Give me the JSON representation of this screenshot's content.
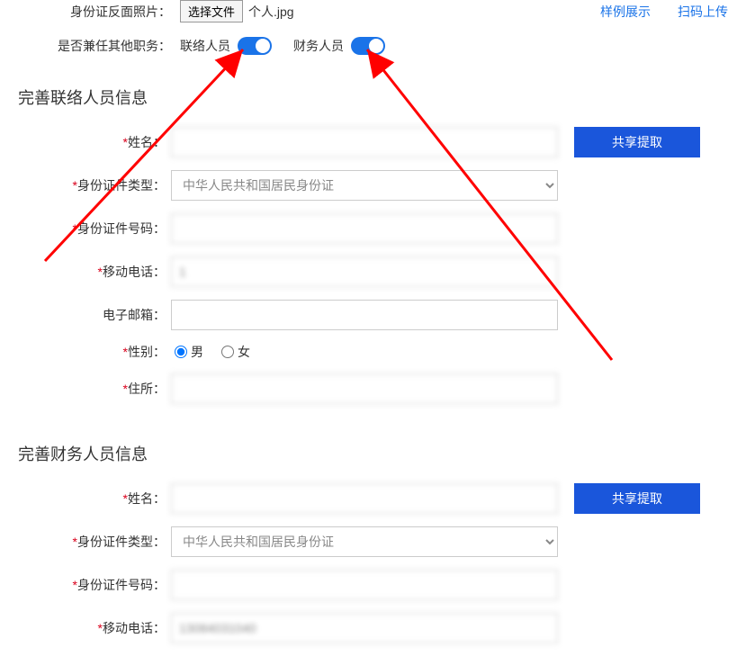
{
  "upload": {
    "label": "身份证反面照片：",
    "button": "选择文件",
    "filename": "个人.jpg",
    "link_sample": "样例展示",
    "link_scan": "扫码上传"
  },
  "switches": {
    "label": "是否兼任其他职务：",
    "option1": "联络人员",
    "option2": "财务人员"
  },
  "contact": {
    "section_title": "完善联络人员信息",
    "name_label": "姓名：",
    "name_value": "　　　",
    "idtype_label": "身份证件类型：",
    "idtype_value": "中华人民共和国居民身份证",
    "idnum_label": "身份证件号码：",
    "idnum_value": "　　　　　　　　　",
    "phone_label": "移动电话：",
    "phone_value": "1　　　　　　",
    "email_label": "电子邮箱：",
    "email_value": "",
    "gender_label": "性别：",
    "gender_male": "男",
    "gender_female": "女",
    "address_label": "住所：",
    "address_value": "　　　　　　　　　　　　　　　",
    "share_btn": "共享提取"
  },
  "finance": {
    "section_title": "完善财务人员信息",
    "name_label": "姓名：",
    "name_value": "　　　",
    "idtype_label": "身份证件类型：",
    "idtype_value": "中华人民共和国居民身份证",
    "idnum_label": "身份证件号码：",
    "idnum_value": "　　　　　　　　　",
    "phone_label": "移动电话：",
    "phone_value": "13084031040",
    "share_btn": "共享提取"
  }
}
